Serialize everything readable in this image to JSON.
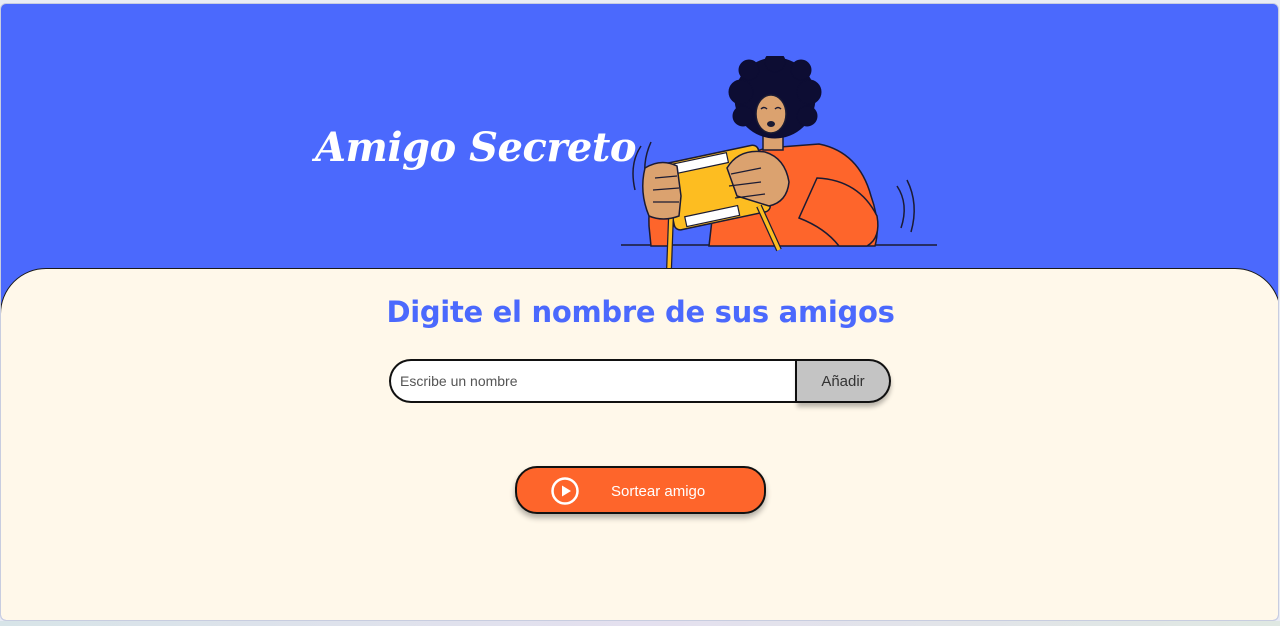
{
  "header": {
    "title": "Amigo Secreto",
    "illustration_icon": "person-holding-gift-illustration"
  },
  "main": {
    "subtitle": "Digite el nombre de sus amigos",
    "input": {
      "placeholder": "Escribe un nombre",
      "value": ""
    },
    "add_button_label": "Añadir",
    "draw_button": {
      "label": "Sortear amigo",
      "icon": "play-circle-icon"
    }
  },
  "colors": {
    "header_bg": "#4b69fd",
    "panel_bg": "#fff8ea",
    "accent": "#fe652b",
    "button_gray": "#c4c4c4",
    "subtitle_blue": "#4b69fd"
  }
}
